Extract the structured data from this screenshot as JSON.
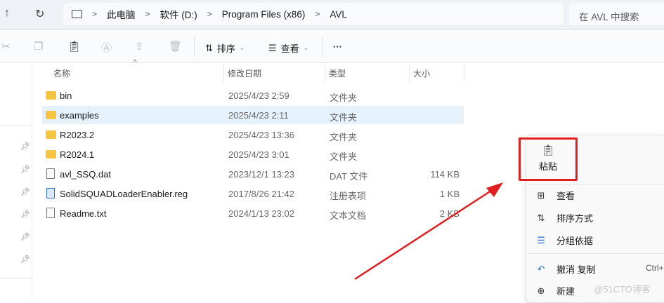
{
  "nav": {
    "up": "↑",
    "refresh": "↻"
  },
  "breadcrumb": [
    "此电脑",
    "软件 (D:)",
    "Program Files (x86)",
    "AVL"
  ],
  "search_placeholder": "在 AVL 中搜索",
  "toolbar": {
    "sort": "排序",
    "view": "查看",
    "more": "···"
  },
  "columns": {
    "name": "名称",
    "date": "修改日期",
    "type": "类型",
    "size": "大小"
  },
  "files": [
    {
      "name": "bin",
      "date": "2025/4/23 2:59",
      "type": "文件夹",
      "size": "",
      "kind": "folder"
    },
    {
      "name": "examples",
      "date": "2025/4/23 2:11",
      "type": "文件夹",
      "size": "",
      "kind": "folder",
      "selected": true
    },
    {
      "name": "R2023.2",
      "date": "2025/4/23 13:36",
      "type": "文件夹",
      "size": "",
      "kind": "folder"
    },
    {
      "name": "R2024.1",
      "date": "2025/4/23 3:01",
      "type": "文件夹",
      "size": "",
      "kind": "folder"
    },
    {
      "name": "avl_SSQ.dat",
      "date": "2023/12/1 13:23",
      "type": "DAT 文件",
      "size": "114 KB",
      "kind": "file"
    },
    {
      "name": "SolidSQUADLoaderEnabler.reg",
      "date": "2017/8/26 21:42",
      "type": "注册表项",
      "size": "1 KB",
      "kind": "reg"
    },
    {
      "name": "Readme.txt",
      "date": "2024/1/13 23:02",
      "type": "文本文档",
      "size": "2 KB",
      "kind": "file"
    }
  ],
  "context_menu": {
    "paste": "粘贴",
    "view": "查看",
    "sort_by": "排序方式",
    "group_by": "分组依据",
    "undo": "撤消 复制",
    "undo_shortcut": "Ctrl+",
    "new": "新建"
  },
  "watermark": "@51CTO博客",
  "colors": {
    "highlight": "#e02020",
    "selection": "#e5f1fb"
  }
}
